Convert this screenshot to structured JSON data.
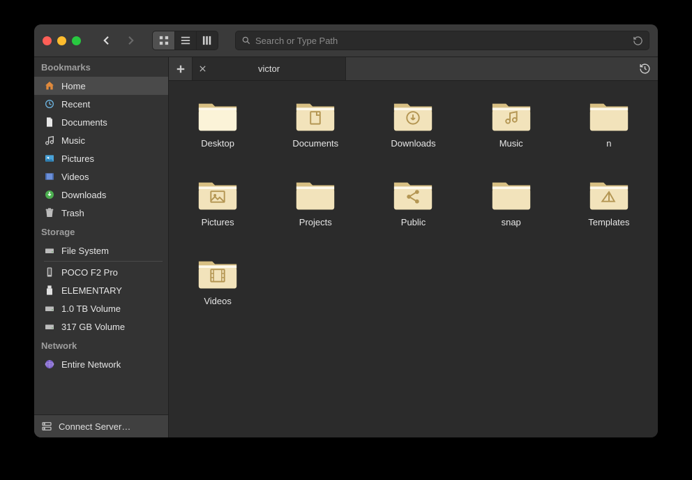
{
  "search": {
    "placeholder": "Search or Type Path"
  },
  "sidebar": {
    "sections": [
      {
        "title": "Bookmarks",
        "items": [
          {
            "label": "Home",
            "icon": "home",
            "selected": true
          },
          {
            "label": "Recent",
            "icon": "recent"
          },
          {
            "label": "Documents",
            "icon": "documents"
          },
          {
            "label": "Music",
            "icon": "music"
          },
          {
            "label": "Pictures",
            "icon": "pictures"
          },
          {
            "label": "Videos",
            "icon": "videos"
          },
          {
            "label": "Downloads",
            "icon": "downloads"
          },
          {
            "label": "Trash",
            "icon": "trash"
          }
        ]
      },
      {
        "title": "Storage",
        "items": [
          {
            "label": "File System",
            "icon": "drive",
            "underline": true
          },
          {
            "label": "POCO F2 Pro",
            "icon": "phone"
          },
          {
            "label": "ELEMENTARY",
            "icon": "usb"
          },
          {
            "label": "1.0 TB Volume",
            "icon": "drive"
          },
          {
            "label": "317 GB Volume",
            "icon": "drive"
          }
        ]
      },
      {
        "title": "Network",
        "items": [
          {
            "label": "Entire Network",
            "icon": "network"
          }
        ]
      }
    ],
    "footer_label": "Connect Server…"
  },
  "tab": {
    "label": "victor"
  },
  "folders": [
    {
      "label": "Desktop",
      "glyph": "desktop"
    },
    {
      "label": "Documents",
      "glyph": "doc"
    },
    {
      "label": "Downloads",
      "glyph": "download"
    },
    {
      "label": "Music",
      "glyph": "music"
    },
    {
      "label": "n",
      "glyph": "plain"
    },
    {
      "label": "Pictures",
      "glyph": "picture"
    },
    {
      "label": "Projects",
      "glyph": "plain"
    },
    {
      "label": "Public",
      "glyph": "share"
    },
    {
      "label": "snap",
      "glyph": "plain"
    },
    {
      "label": "Templates",
      "glyph": "template"
    },
    {
      "label": "Videos",
      "glyph": "video"
    }
  ],
  "colors": {
    "folder_light": "#f2e3bb",
    "folder_mid": "#e3cd95",
    "folder_tab": "#d8c084",
    "folder_glyph": "#b49653",
    "desktop_light": "#fbf3d8",
    "desktop_mid": "#f0e2b3"
  }
}
